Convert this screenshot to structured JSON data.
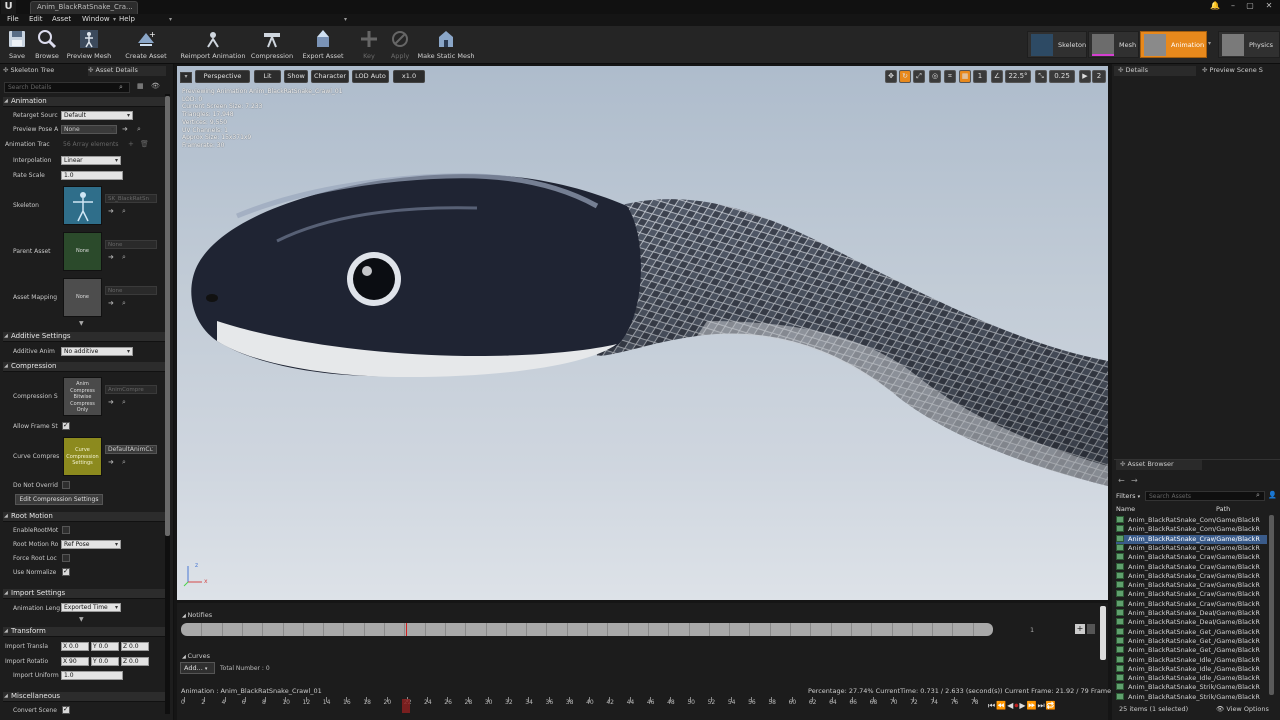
{
  "window": {
    "tab_title": "Anim_BlackRatSnake_Cra...",
    "logo": "U"
  },
  "menu": [
    "File",
    "Edit",
    "Asset",
    "Window",
    "Help"
  ],
  "toolbar": [
    {
      "label": "Save",
      "icon": "save-icon"
    },
    {
      "label": "Browse",
      "icon": "browse-icon"
    },
    {
      "label": "Preview Mesh",
      "icon": "preview-mesh-icon"
    },
    {
      "label": "Create Asset",
      "icon": "create-asset-icon"
    },
    {
      "label": "Reimport Animation",
      "icon": "reimport-icon"
    },
    {
      "label": "Compression",
      "icon": "compression-icon"
    },
    {
      "label": "Export Asset",
      "icon": "export-icon"
    },
    {
      "label": "Key",
      "icon": "plus-icon",
      "disabled": true
    },
    {
      "label": "Apply",
      "icon": "apply-icon",
      "disabled": true
    },
    {
      "label": "Make Static Mesh",
      "icon": "make-static-mesh-icon"
    }
  ],
  "modes": [
    "Skeleton",
    "Mesh",
    "Animation",
    "Physics"
  ],
  "left_tabs": [
    "Skeleton Tree",
    "Asset Details"
  ],
  "search_details_placeholder": "Search Details",
  "sections": {
    "animation": "Animation",
    "additive": "Additive Settings",
    "compression": "Compression",
    "root_motion": "Root Motion",
    "import": "Import Settings",
    "transform": "Transform",
    "misc": "Miscellaneous"
  },
  "props": {
    "retarget_label": "Retarget Sourc",
    "retarget_value": "Default",
    "preview_pose_label": "Preview Pose A",
    "preview_pose_value": "None",
    "anim_track_label": "Animation Trac",
    "anim_track_value": "56 Array elements",
    "interp_label": "Interpolation",
    "interp_value": "Linear",
    "rate_label": "Rate Scale",
    "rate_value": "1.0",
    "skeleton_label": "Skeleton",
    "skeleton_value": "SK_BlackRatSn",
    "parent_label": "Parent Asset",
    "parent_tile": "None",
    "parent_value": "None",
    "mapping_label": "Asset Mapping",
    "mapping_tile": "None",
    "mapping_value": "None",
    "additive_label": "Additive Anim",
    "additive_value": "No additive",
    "compression_label": "Compression S",
    "compression_tile": "Anim Compress Bitwise Compress Only",
    "compression_value": "AnimCompre",
    "allow_frame_label": "Allow Frame St",
    "curve_label": "Curve Compres",
    "curve_tile": "Curve Compression Settings",
    "curve_value": "DefaultAnimCu",
    "donot_label": "Do Not Overrid",
    "edit_btn": "Edit Compression Settings",
    "enable_root_label": "EnableRootMot",
    "root_mode_label": "Root Motion Ro",
    "root_mode_value": "Ref Pose",
    "force_root_label": "Force Root Loc",
    "use_norm_label": "Use Normalize",
    "anim_len_label": "Animation Leng",
    "anim_len_value": "Exported Time",
    "imp_trans_label": "Import Transla",
    "imp_trans": [
      "X 0.0",
      "Y 0.0",
      "Z 0.0"
    ],
    "imp_rot_label": "Import Rotatio",
    "imp_rot": [
      "X 90",
      "Y 0.0",
      "Z 0.0"
    ],
    "imp_uni_label": "Import Uniform",
    "imp_uni_value": "1.0",
    "convert_label": "Convert Scene"
  },
  "viewport": {
    "perspective": "Perspective",
    "lit": "Lit",
    "show": "Show",
    "character": "Character",
    "lod": "LOD Auto",
    "speed": "x1.0",
    "angle": "22.5°",
    "scale": "0.25",
    "cam_speed": "2",
    "grid_num": "1",
    "stats": [
      "Previewing Animation Anim_BlackRatSnake_Crawl_01",
      "LOD: 0",
      "Current Screen Size: 7.233",
      "Triangles: 17,948",
      "Vertices: 9,550",
      "UV Channels: 1",
      "Approx Size: 15x371x9",
      "Framerate: 30"
    ],
    "axis_z": "z",
    "axis_x": "x"
  },
  "timeline": {
    "notifies": "Notifies",
    "track_num": "1",
    "curves": "Curves",
    "add": "Add...",
    "total": "Total Number : 0",
    "anim_label": "Animation :",
    "anim_name": "Anim_BlackRatSnake_Crawl_01",
    "status": "Percentage:  27.74%  CurrentTime:  0.731 / 2.633 (second(s))  Current Frame:  21.92 / 79 Frame",
    "ticks": [
      0,
      2,
      4,
      6,
      8,
      10,
      12,
      14,
      16,
      18,
      20,
      22,
      24,
      26,
      28,
      30,
      32,
      34,
      36,
      38,
      40,
      42,
      44,
      46,
      48,
      50,
      52,
      54,
      56,
      58,
      60,
      62,
      64,
      66,
      68,
      70,
      72,
      74,
      76,
      78
    ],
    "progress_frame": 21.92,
    "total_frames": 79
  },
  "right_tabs": [
    "Details",
    "Preview Scene S"
  ],
  "asset_browser": {
    "title": "Asset Browser",
    "filters": "Filters",
    "search_placeholder": "Search Assets",
    "col_name": "Name",
    "col_path": "Path",
    "items": [
      {
        "name": "Anim_BlackRatSnake_Com",
        "path": "/Game/BlackR"
      },
      {
        "name": "Anim_BlackRatSnake_Com",
        "path": "/Game/BlackR"
      },
      {
        "name": "Anim_BlackRatSnake_Craw",
        "path": "/Game/BlackR",
        "selected": true
      },
      {
        "name": "Anim_BlackRatSnake_Craw",
        "path": "/Game/BlackR"
      },
      {
        "name": "Anim_BlackRatSnake_Craw",
        "path": "/Game/BlackR"
      },
      {
        "name": "Anim_BlackRatSnake_Craw",
        "path": "/Game/BlackR"
      },
      {
        "name": "Anim_BlackRatSnake_Craw",
        "path": "/Game/BlackR"
      },
      {
        "name": "Anim_BlackRatSnake_Craw",
        "path": "/Game/BlackR"
      },
      {
        "name": "Anim_BlackRatSnake_Craw",
        "path": "/Game/BlackR"
      },
      {
        "name": "Anim_BlackRatSnake_Craw",
        "path": "/Game/BlackR"
      },
      {
        "name": "Anim_BlackRatSnake_Deat",
        "path": "/Game/BlackR"
      },
      {
        "name": "Anim_BlackRatSnake_Deat",
        "path": "/Game/BlackR"
      },
      {
        "name": "Anim_BlackRatSnake_Get_",
        "path": "/Game/BlackR"
      },
      {
        "name": "Anim_BlackRatSnake_Get_",
        "path": "/Game/BlackR"
      },
      {
        "name": "Anim_BlackRatSnake_Get_",
        "path": "/Game/BlackR"
      },
      {
        "name": "Anim_BlackRatSnake_Idle_",
        "path": "/Game/BlackR"
      },
      {
        "name": "Anim_BlackRatSnake_Idle_",
        "path": "/Game/BlackR"
      },
      {
        "name": "Anim_BlackRatSnake_Idle_",
        "path": "/Game/BlackR"
      },
      {
        "name": "Anim_BlackRatSnake_Strik",
        "path": "/Game/BlackR"
      },
      {
        "name": "Anim_BlackRatSnake_Strik",
        "path": "/Game/BlackR"
      }
    ],
    "footer": "25 items (1 selected)",
    "view_options": "View Options"
  },
  "colors": {
    "accent_orange": "#e8891c",
    "asset_green": "#5fa06d",
    "selected_blue": "#3a5b8a"
  }
}
